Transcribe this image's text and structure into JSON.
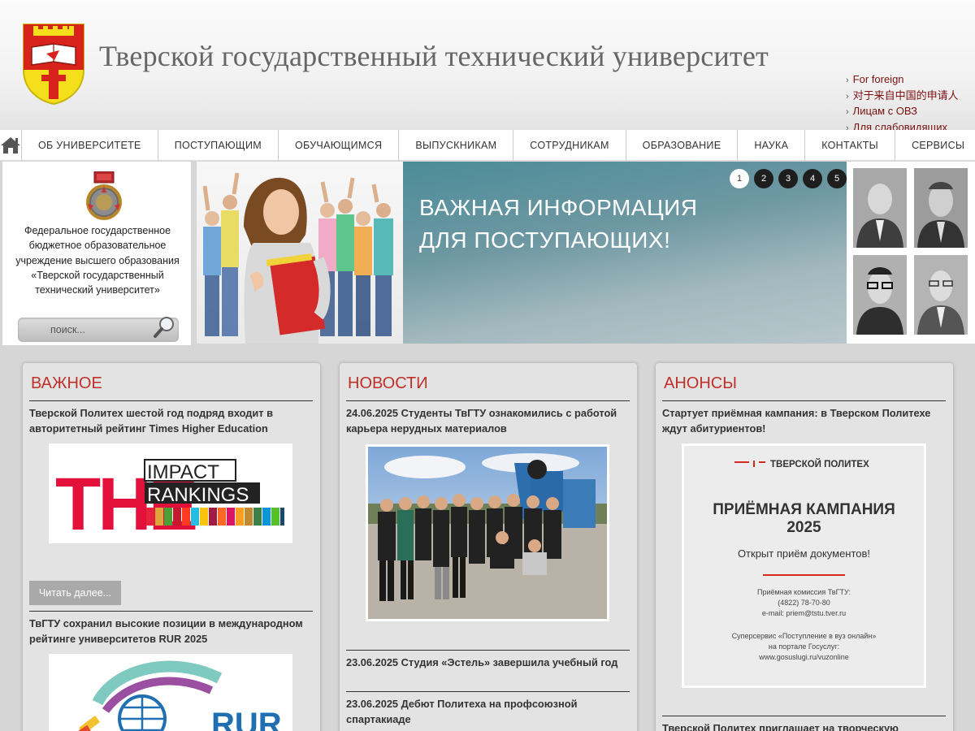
{
  "header": {
    "title": "Тверской государственный технический университет",
    "links": [
      "For foreign",
      "对于来自中国的申请人",
      "Лицам с ОВЗ",
      "Для слабовидящих"
    ]
  },
  "nav": {
    "items": [
      "ОБ УНИВЕРСИТЕТЕ",
      "ПОСТУПАЮЩИМ",
      "ОБУЧАЮЩИМСЯ",
      "ВЫПУСКНИКАМ",
      "СОТРУДНИКАМ",
      "ОБРАЗОВАНИЕ",
      "НАУКА",
      "КОНТАКТЫ",
      "СЕРВИСЫ"
    ]
  },
  "left_info": {
    "org_text": "Федеральное государственное бюджетное образовательное учреждение высшего образования «Тверской государственный технический университет»",
    "search_placeholder": "поиск..."
  },
  "banner": {
    "headline_line1": "ВАЖНАЯ ИНФОРМАЦИЯ",
    "headline_line2": "ДЛЯ ПОСТУПАЮЩИХ!",
    "slides": [
      "1",
      "2",
      "3",
      "4",
      "5"
    ],
    "active_slide": 1
  },
  "important": {
    "title": "ВАЖНОЕ",
    "item1": "Тверской Политех шестой год подряд входит в авторитетный рейтинг Times Higher Education",
    "logo_big": "THE",
    "logo_line1": "IMPACT",
    "logo_line2": "RANKINGS",
    "read_more": "Читать далее...",
    "item2": "ТвГТУ сохранил высокие позиции в международном рейтинге университетов RUR 2025",
    "rur_logo": "RUR"
  },
  "news": {
    "title": "НОВОСТИ",
    "item1": "24.06.2025 Студенты ТвГТУ ознакомились с работой карьера нерудных материалов",
    "item2": "23.06.2025 Студия «Эстель» завершила учебный год",
    "item3": "23.06.2025 Дебют Политеха на профсоюзной спартакиаде"
  },
  "announcements": {
    "title": "АНОНСЫ",
    "item1": "Стартует приёмная кампания: в Тверском Политехе ждут абитуриентов!",
    "poster_brand": "ТВЕРСКОЙ ПОЛИТЕХ",
    "poster_title1": "ПРИЁМНАЯ КАМПАНИЯ",
    "poster_title2": "2025",
    "poster_subtitle": "Открыт приём документов!",
    "poster_contact1": "Приёмная комиссия ТвГТУ:",
    "poster_contact2": "(4822) 78-70-80",
    "poster_contact3": "e-mail: priem@tstu.tver.ru",
    "poster_service1": "Суперсервис «Поступление в вуз онлайн»",
    "poster_service2": "на портале Госуслуг:",
    "poster_service3": "www.gosuslugi.ru/vuzonline",
    "item2": "Тверской Политех приглашает на творческую"
  },
  "colors": {
    "accent_red": "#c0302a",
    "link_dark_red": "#7a1010"
  }
}
